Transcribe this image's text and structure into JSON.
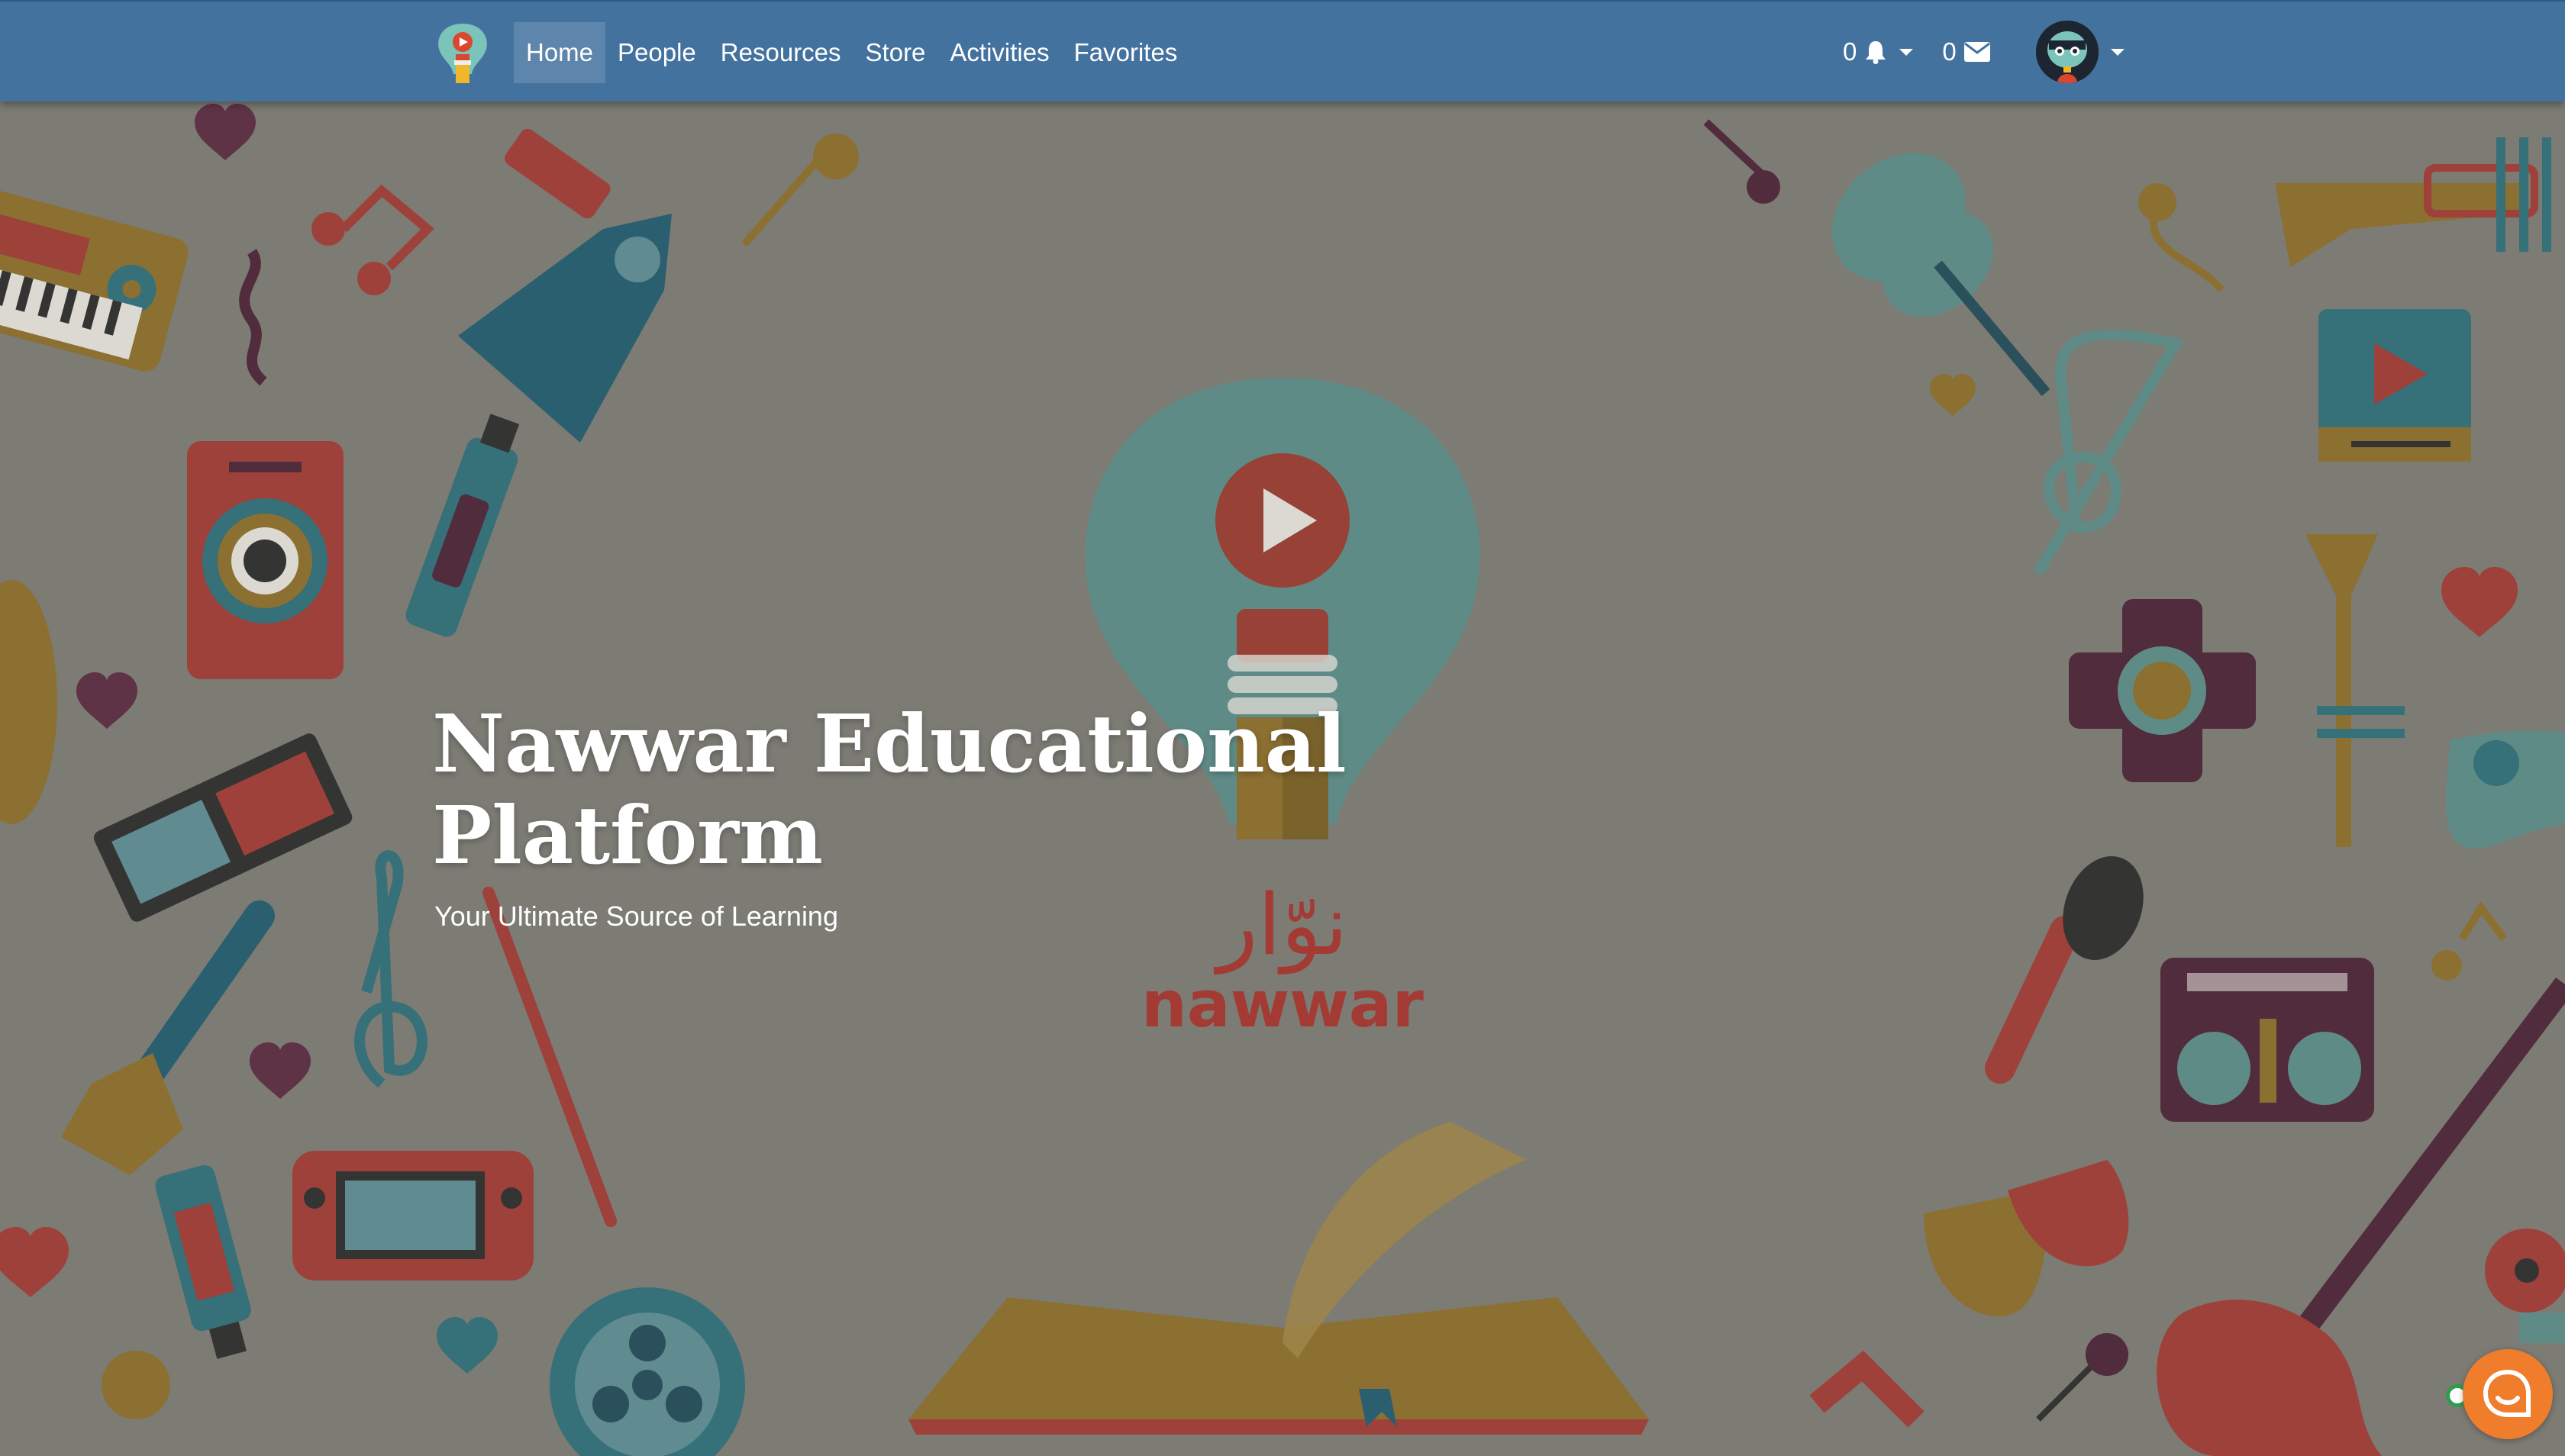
{
  "nav": {
    "logo_icon": "nawwar-bulb-logo-icon",
    "links": [
      {
        "label": "Home",
        "active": true
      },
      {
        "label": "People",
        "active": false
      },
      {
        "label": "Resources",
        "active": false
      },
      {
        "label": "Store",
        "active": false
      },
      {
        "label": "Activities",
        "active": false
      },
      {
        "label": "Favorites",
        "active": false
      }
    ],
    "notifications": {
      "count": "0",
      "icon": "bell-icon"
    },
    "messages": {
      "count": "0",
      "icon": "envelope-icon"
    },
    "avatar_icon": "user-avatar-icon"
  },
  "hero": {
    "title": "Nawwar Educational Platform",
    "subtitle": "Your Ultimate Source of Learning",
    "logo_arabic": "نوّار",
    "logo_latin": "nawwar"
  },
  "chat": {
    "icon": "chat-bubble-icon",
    "status_icon": "online-status-icon"
  },
  "colors": {
    "navbar": "#44729e",
    "overlay_bg": "#7d7b75",
    "chat": "#ef7d2c",
    "logo_red": "#b4362c"
  }
}
